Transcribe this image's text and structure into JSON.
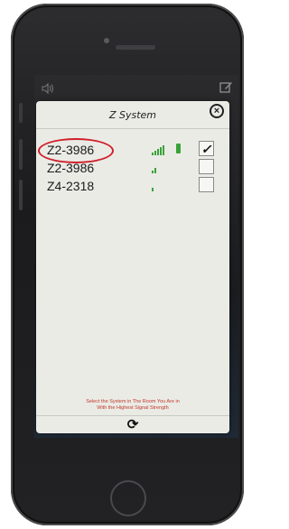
{
  "header": {
    "title": "Z System",
    "close_icon": "close-circle-icon"
  },
  "top_bar": {
    "left_icon": "speaker-icon",
    "right_icon": "edit-icon"
  },
  "systems": [
    {
      "name": "Z2-3986",
      "signal_bars": 5,
      "battery": true,
      "selected": true,
      "check": "✓"
    },
    {
      "name": "Z2-3986",
      "signal_bars": 2,
      "battery": false,
      "selected": false,
      "check": ""
    },
    {
      "name": "Z4-2318",
      "signal_bars": 1,
      "battery": false,
      "selected": false,
      "check": ""
    }
  ],
  "instruction": {
    "line1": "Select the System in The Room You Are in",
    "line2": "With the Highest Signal Strength"
  },
  "footer": {
    "refresh_icon": "refresh-icon"
  },
  "colors": {
    "signal": "#3aa23a",
    "highlight": "#d0202a",
    "instruction": "#c0392b"
  }
}
